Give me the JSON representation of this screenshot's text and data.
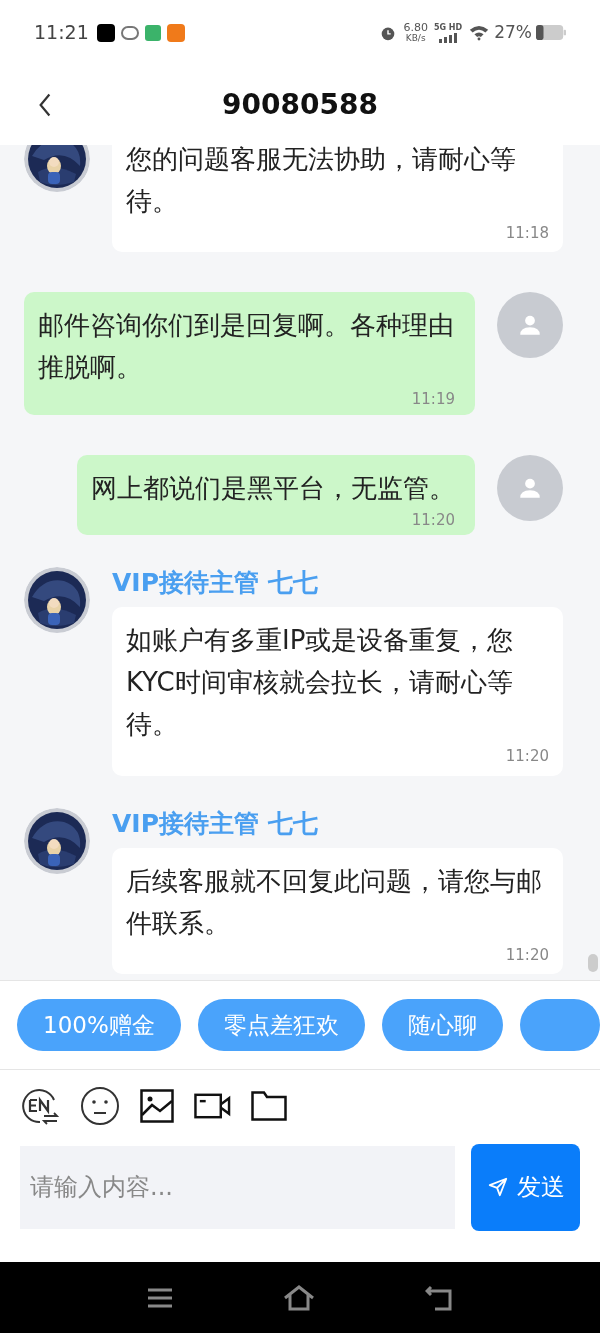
{
  "status_bar": {
    "time": "11:21",
    "speed": "6.80",
    "speed_unit": "KB/s",
    "network": "5G HD",
    "battery": "27%"
  },
  "header": {
    "title": "90080588"
  },
  "messages": [
    {
      "kind": "agent",
      "text": "您的问题客服无法协助，请耐心等待。",
      "time": "11:18"
    },
    {
      "kind": "user",
      "text": "邮件咨询你们到是回复啊。各种理由推脱啊。",
      "time": "11:19"
    },
    {
      "kind": "user",
      "text": "网上都说们是黑平台，无监管。",
      "time": "11:20"
    },
    {
      "kind": "agent",
      "name": "VIP接待主管 七七",
      "text": "如账户有多重IP或是设备重复，您KYC时间审核就会拉长，请耐心等待。",
      "time": "11:20"
    },
    {
      "kind": "agent",
      "name": "VIP接待主管 七七",
      "text": "后续客服就不回复此问题，请您与邮件联系。",
      "time": "11:20"
    }
  ],
  "quick_replies": [
    "100%赠金",
    "零点差狂欢",
    "随心聊"
  ],
  "composer": {
    "placeholder": "请输入内容...",
    "send": "发送"
  }
}
